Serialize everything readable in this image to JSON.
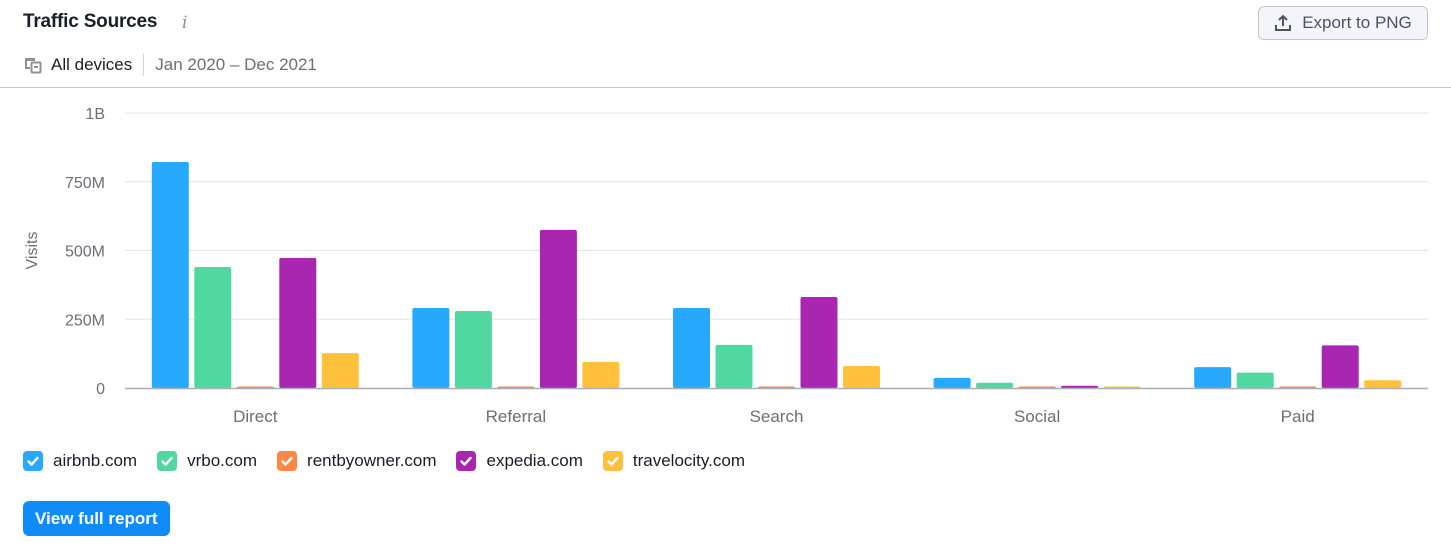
{
  "header": {
    "title": "Traffic Sources",
    "info_icon": "info-icon",
    "export_label": "Export to PNG",
    "export_icon": "upload-icon",
    "devices_icon": "devices-icon",
    "devices_label": "All devices",
    "date_range": "Jan 2020 – Dec 2021"
  },
  "footer": {
    "report_label": "View full report"
  },
  "chart_data": {
    "type": "bar",
    "title": "Traffic Sources",
    "xlabel": "",
    "ylabel": "Visits",
    "ylim": [
      0,
      1000000000
    ],
    "yticks": [
      {
        "value": 0,
        "label": "0"
      },
      {
        "value": 250000000,
        "label": "250M"
      },
      {
        "value": 500000000,
        "label": "500M"
      },
      {
        "value": 750000000,
        "label": "750M"
      },
      {
        "value": 1000000000,
        "label": "1B"
      }
    ],
    "grid": true,
    "legend_position": "bottom-left",
    "categories": [
      "Direct",
      "Referral",
      "Search",
      "Social",
      "Paid"
    ],
    "series": [
      {
        "name": "airbnb.com",
        "color": "#27a9ff",
        "checked": true,
        "values": [
          822000000,
          291000000,
          291000000,
          37000000,
          76000000
        ]
      },
      {
        "name": "vrbo.com",
        "color": "#51d8a1",
        "checked": true,
        "values": [
          440000000,
          280000000,
          157000000,
          19000000,
          56000000
        ]
      },
      {
        "name": "rentbyowner.com",
        "color": "#ff8744",
        "checked": true,
        "values": [
          5000000,
          4000000,
          4000000,
          1000000,
          4000000
        ]
      },
      {
        "name": "expedia.com",
        "color": "#a926b1",
        "checked": true,
        "values": [
          473000000,
          575000000,
          331000000,
          8000000,
          155000000
        ]
      },
      {
        "name": "travelocity.com",
        "color": "#ffc13b",
        "checked": true,
        "values": [
          127000000,
          95000000,
          80000000,
          2000000,
          28000000
        ]
      }
    ]
  }
}
